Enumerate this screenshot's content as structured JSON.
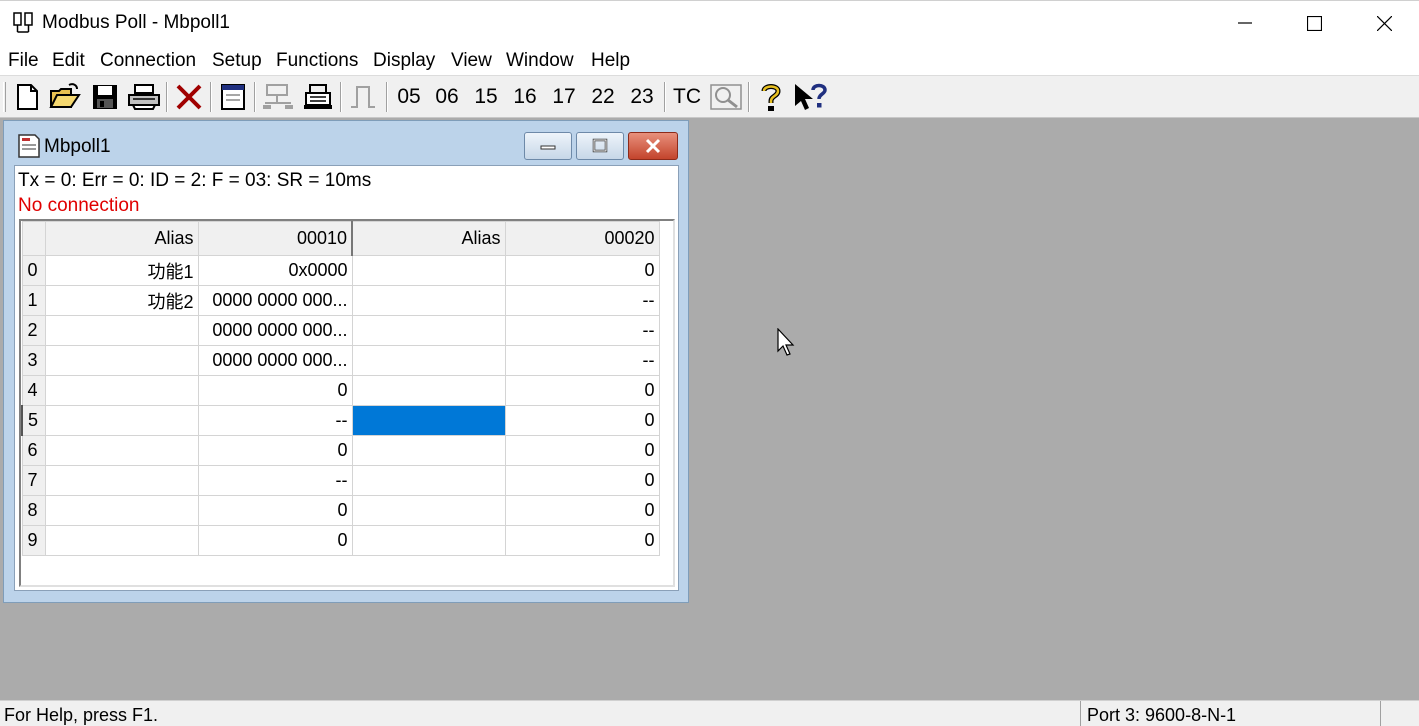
{
  "window": {
    "title": "Modbus Poll - Mbpoll1"
  },
  "menu": [
    "File",
    "Edit",
    "Connection",
    "Setup",
    "Functions",
    "Display",
    "View",
    "Window",
    "Help"
  ],
  "toolbar": {
    "function_codes": [
      "05",
      "06",
      "15",
      "16",
      "17",
      "22",
      "23"
    ],
    "tc_label": "TC"
  },
  "child": {
    "title": "Mbpoll1",
    "status": "Tx = 0: Err = 0: ID = 2: F = 03: SR = 10ms",
    "connection": "No connection",
    "connection_color": "#e00000",
    "columns": [
      "Alias",
      "00010",
      "Alias",
      "00020"
    ],
    "rows": [
      {
        "index": "0",
        "alias1": "功能1",
        "val1": "0x0000",
        "alias2": "",
        "val2": "0"
      },
      {
        "index": "1",
        "alias1": "功能2",
        "val1": "0000 0000 000...",
        "alias2": "",
        "val2": "--"
      },
      {
        "index": "2",
        "alias1": "",
        "val1": "0000 0000 000...",
        "alias2": "",
        "val2": "--"
      },
      {
        "index": "3",
        "alias1": "",
        "val1": "0000 0000 000...",
        "alias2": "",
        "val2": "--"
      },
      {
        "index": "4",
        "alias1": "",
        "val1": "0",
        "alias2": "",
        "val2": "0"
      },
      {
        "index": "5",
        "alias1": "",
        "val1": "--",
        "alias2": "",
        "val2": "0"
      },
      {
        "index": "6",
        "alias1": "",
        "val1": "0",
        "alias2": "",
        "val2": "0"
      },
      {
        "index": "7",
        "alias1": "",
        "val1": "--",
        "alias2": "",
        "val2": "0"
      },
      {
        "index": "8",
        "alias1": "",
        "val1": "0",
        "alias2": "",
        "val2": "0"
      },
      {
        "index": "9",
        "alias1": "",
        "val1": "0",
        "alias2": "",
        "val2": "0"
      }
    ]
  },
  "statusbar": {
    "help": "For Help, press F1.",
    "port": "Port 3: 9600-8-N-1"
  }
}
